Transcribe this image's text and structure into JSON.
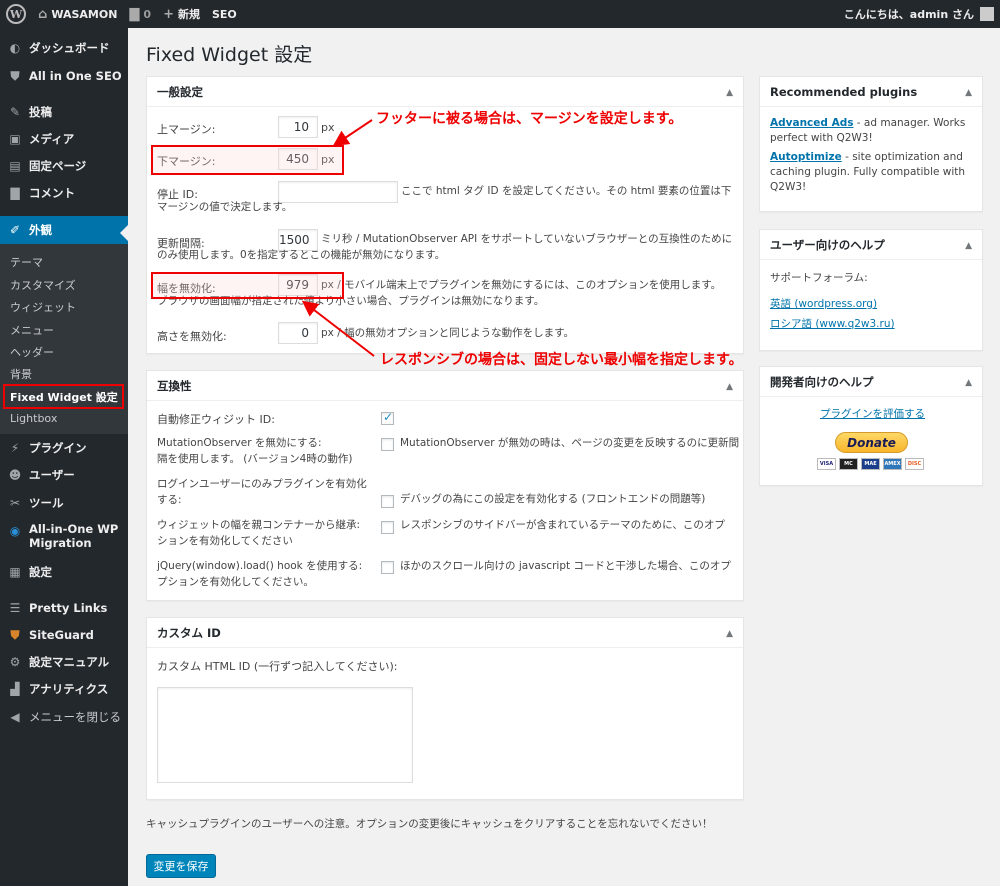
{
  "adminbar": {
    "site_name": "WASAMON",
    "comments_count": "0",
    "new_label": "新規",
    "seo_label": "SEO",
    "greeting": "こんにちは、admin さん"
  },
  "sidebar": {
    "items": [
      {
        "label": "ダッシュボード",
        "icon": "dashboard-icon"
      },
      {
        "label": "All in One SEO",
        "icon": "shield-icon"
      },
      {
        "label": "投稿",
        "icon": "pin-icon"
      },
      {
        "label": "メディア",
        "icon": "media-icon"
      },
      {
        "label": "固定ページ",
        "icon": "page-icon"
      },
      {
        "label": "コメント",
        "icon": "comment-icon"
      },
      {
        "label": "外観",
        "icon": "brush-icon"
      },
      {
        "label": "プラグイン",
        "icon": "plugin-icon"
      },
      {
        "label": "ユーザー",
        "icon": "user-icon"
      },
      {
        "label": "ツール",
        "icon": "wrench-icon"
      },
      {
        "label": "All-in-One WP Migration",
        "icon": "migration-icon"
      },
      {
        "label": "設定",
        "icon": "settings-icon"
      },
      {
        "label": "Pretty Links",
        "icon": "star-icon"
      },
      {
        "label": "SiteGuard",
        "icon": "guard-icon"
      },
      {
        "label": "設定マニュアル",
        "icon": "gear-icon"
      },
      {
        "label": "アナリティクス",
        "icon": "chart-icon"
      },
      {
        "label": "メニューを閉じる",
        "icon": "collapse-icon"
      }
    ],
    "submenu": [
      "テーマ",
      "カスタマイズ",
      "ウィジェット",
      "メニュー",
      "ヘッダー",
      "背景",
      "Fixed Widget 設定",
      "Lightbox"
    ]
  },
  "page": {
    "title": "Fixed Widget 設定"
  },
  "general": {
    "heading": "一般設定",
    "margin_top_label": "上マージン:",
    "margin_top_value": "10",
    "margin_bottom_label": "下マージン:",
    "margin_bottom_value": "450",
    "unit_px": "px",
    "stop_id_label": "停止 ID:",
    "stop_id_value": "",
    "stop_id_desc": "ここで html タグ ID を設定してください。その html 要素の位置は下マージンの値で決定します。",
    "refresh_label": "更新間隔:",
    "refresh_value": "1500",
    "refresh_desc": "ミリ秒 / MutationObserver API をサポートしていないブラウザーとの互換性のためにのみ使用します。0を指定するとこの機能が無効になります。",
    "disable_width_label": "幅を無効化:",
    "disable_width_value": "979",
    "disable_width_desc": "px / モバイル端末上でプラグインを無効にするには、このオプションを使用します。 ブラウザの画面幅が指定された値より小さい場合、プラグインは無効になります。",
    "disable_height_label": "高さを無効化:",
    "disable_height_value": "0",
    "disable_height_desc": "px / 幅の無効オプションと同じような動作をします。"
  },
  "compat": {
    "heading": "互換性",
    "auto_fix_label": "自動修正ウィジット ID:",
    "auto_fix_checked": true,
    "mutation_label": "MutationObserver を無効にする:\n隔を使用します。 (バージョン4時の動作)",
    "mutation_desc": "MutationObserver が無効の時は、ページの変更を反映するのに更新間",
    "login_label": "ログインユーザーにのみプラグインを有効化する:",
    "login_desc": "デバッグの為にこの設定を有効化する (フロントエンドの問題等)",
    "inherit_label": "ウィジェットの幅を親コンテナーから継承:\nションを有効化してください",
    "inherit_desc": "レスポンシブのサイドバーが含まれているテーマのために、このオプ",
    "jquery_label": "jQuery(window).load() hook を使用する:\nプションを有効化してください。",
    "jquery_desc": "ほかのスクロール向けの javascript コードと干渉した場合、このオプ"
  },
  "custom": {
    "heading": "カスタム ID",
    "html_id_label": "カスタム HTML ID (一行ずつ記入してください):",
    "html_id_value": ""
  },
  "notice": "キャッシュプラグインのユーザーへの注意。オプションの変更後にキャッシュをクリアすることを忘れないでください！",
  "save_label": "変更を保存",
  "recommended": {
    "heading": "Recommended plugins",
    "p1_link": "Advanced Ads",
    "p1_text": " - ad manager. Works perfect with Q2W3!",
    "p2_link": "Autoptimize",
    "p2_text": " - site optimization and caching plugin. Fully compatible with Q2W3!"
  },
  "user_help": {
    "heading": "ユーザー向けのヘルプ",
    "forum_label": "サポートフォーラム:",
    "link_en": "英語 (wordpress.org)",
    "link_ru": "ロシア語 (www.q2w3.ru)"
  },
  "dev_help": {
    "heading": "開発者向けのヘルプ",
    "rate_link": "プラグインを評価する",
    "donate_label": "Donate",
    "cards": [
      "VISA",
      "MC",
      "MAE",
      "AMEX",
      "DISC"
    ]
  },
  "annotations": {
    "footer_note": "フッターに被る場合は、マージンを設定します。",
    "responsive_note": "レスポンシブの場合は、固定しない最小幅を指定します。"
  },
  "colors": {
    "accent": "#0073aa",
    "annotation": "#ee0000",
    "sidebar_bg": "#23282d"
  }
}
